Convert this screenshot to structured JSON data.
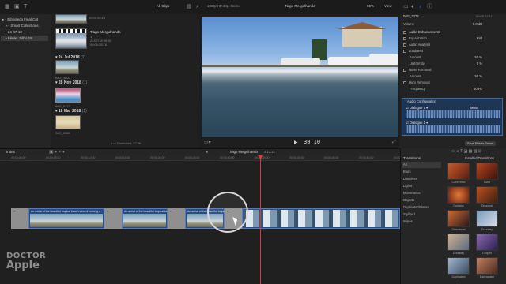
{
  "library": {
    "items": [
      {
        "label": "Biblioteca Final Cut"
      },
      {
        "label": "Smart Collections"
      },
      {
        "label": "24-07-18"
      },
      {
        "label": "Férias Julho 18"
      }
    ]
  },
  "browser": {
    "filter": "All Clips",
    "top_clip": {
      "timecode": "00:00:28:16"
    },
    "project": {
      "title": "Tiago Mergulhando",
      "line1": "1",
      "line2": "24/07/18 09:50",
      "line3": "00:00:28:16"
    },
    "dates": [
      {
        "label": "24 Jul 2018",
        "count": "(1)"
      },
      {
        "label": "28 Nov 2018",
        "count": "(1)"
      },
      {
        "label": "18 Mar 2018",
        "count": "(1)"
      }
    ],
    "clips": [
      {
        "label": "IMG_3000"
      },
      {
        "label": "IMG_6173"
      },
      {
        "label": "IMG_0285"
      }
    ],
    "status": "1 of 7 selected, 27:06"
  },
  "viewer": {
    "format": "1080p HD 30p, Stereo",
    "title": "Tiago Mergulhando",
    "zoom": "50%",
    "view": "View",
    "timecode": "30:10"
  },
  "inspector": {
    "file": "IMG_3273",
    "timecode": "00:00:12:11",
    "rows": [
      {
        "label": "Volume",
        "value": "0.0 dB"
      },
      {
        "label": "Audio Enhancements",
        "value": ""
      },
      {
        "label": "Equalization",
        "value": "Flat"
      },
      {
        "label": "Audio Analysis",
        "value": ""
      },
      {
        "label": "Loudness",
        "value": ""
      },
      {
        "label": "Amount",
        "value": "50 %"
      },
      {
        "label": "Uniformity",
        "value": "0 %"
      },
      {
        "label": "Noise Removal",
        "value": ""
      },
      {
        "label": "Amount",
        "value": "50 %"
      },
      {
        "label": "Hum Removal",
        "value": ""
      },
      {
        "label": "Frequency",
        "value": "50 Hz"
      }
    ],
    "audio_config": "Audio Configuration",
    "channel1": "Dialogue 1",
    "channel2": "Dialogue 1",
    "mono": "Mono",
    "save_btn": "Save Effects Preset"
  },
  "timeline": {
    "index": "Index",
    "project": "Tiago Mergulhando",
    "duration": "4:12:21",
    "ticks": [
      "00:00:00:00",
      "00:00:05:00",
      "00:00:10:00",
      "00:00:15:00",
      "00:00:20:00",
      "00:00:25:00",
      "00:00:30:00",
      "00:00:35:00",
      "00:00:40:00",
      "00:00:45:00",
      "00:00:50:00",
      "00:00:55:00"
    ],
    "clip_label": "An aerial of the beautiful tropical beach view of Iceberg c"
  },
  "transitions": {
    "header": "Transitions",
    "installed": "Installed Transitions",
    "categories": [
      "All",
      "Blurs",
      "Dissolves",
      "Lights",
      "Movements",
      "Objects",
      "Replicator/Clones",
      "Stylized",
      "Wipes"
    ],
    "items": [
      {
        "label": "Concentric"
      },
      {
        "label": "Cube"
      },
      {
        "label": "Curtains"
      },
      {
        "label": "Diagonal"
      },
      {
        "label": "Directional"
      },
      {
        "label": "Doorway"
      },
      {
        "label": "Doorway"
      },
      {
        "label": "Drop In"
      },
      {
        "label": "Duplicated"
      },
      {
        "label": "Earthquake"
      }
    ]
  },
  "watermark": {
    "line1": "DOCTOR",
    "line2": "Apple"
  }
}
